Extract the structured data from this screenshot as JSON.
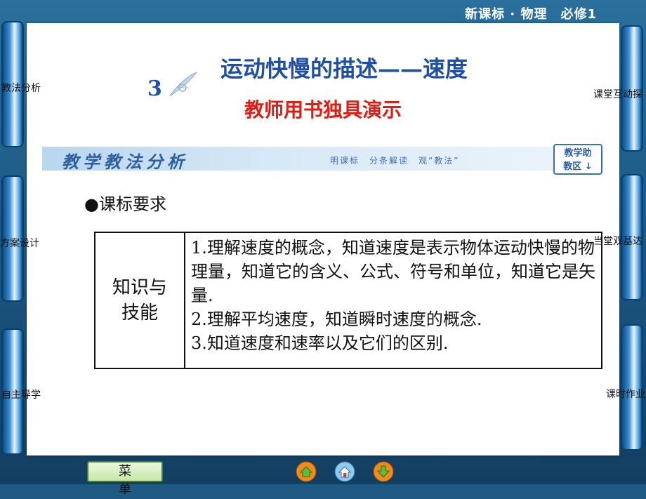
{
  "header": {
    "text": "新课标 · 物理　必修1"
  },
  "left_tabs": [
    "教法分析",
    "方案设计",
    "自主导学"
  ],
  "right_tabs": [
    "课堂互动探",
    "当堂双基达",
    "课时作业"
  ],
  "lesson": {
    "number": "3",
    "title": "运动快慢的描述——速度",
    "subtitle": "教师用书独具演示"
  },
  "banner": {
    "title": "教学教法分析",
    "subtitle": "明课标　分条解读　观“教法”",
    "help_line1": "教学助",
    "help_line2": "教区 ↓"
  },
  "section": {
    "heading": "●课标要求"
  },
  "requirements": {
    "label_line1": "知识与",
    "label_line2": "技能",
    "items": [
      "1.理解速度的概念，知道速度是表示物体运动快慢的物理量，知道它的含义、公式、符号和单位，知道它是矢量.",
      "2.理解平均速度，知道瞬时速度的概念.",
      "3.知道速度和速率以及它们的区别."
    ]
  },
  "footer": {
    "menu_label": "菜单"
  },
  "icons": [
    "home-icon",
    "house-icon",
    "back-icon"
  ],
  "colors": {
    "title_blue": "#1d4fa6",
    "subtitle_red": "#e31b12",
    "frame_blue": "#1f5a84"
  }
}
